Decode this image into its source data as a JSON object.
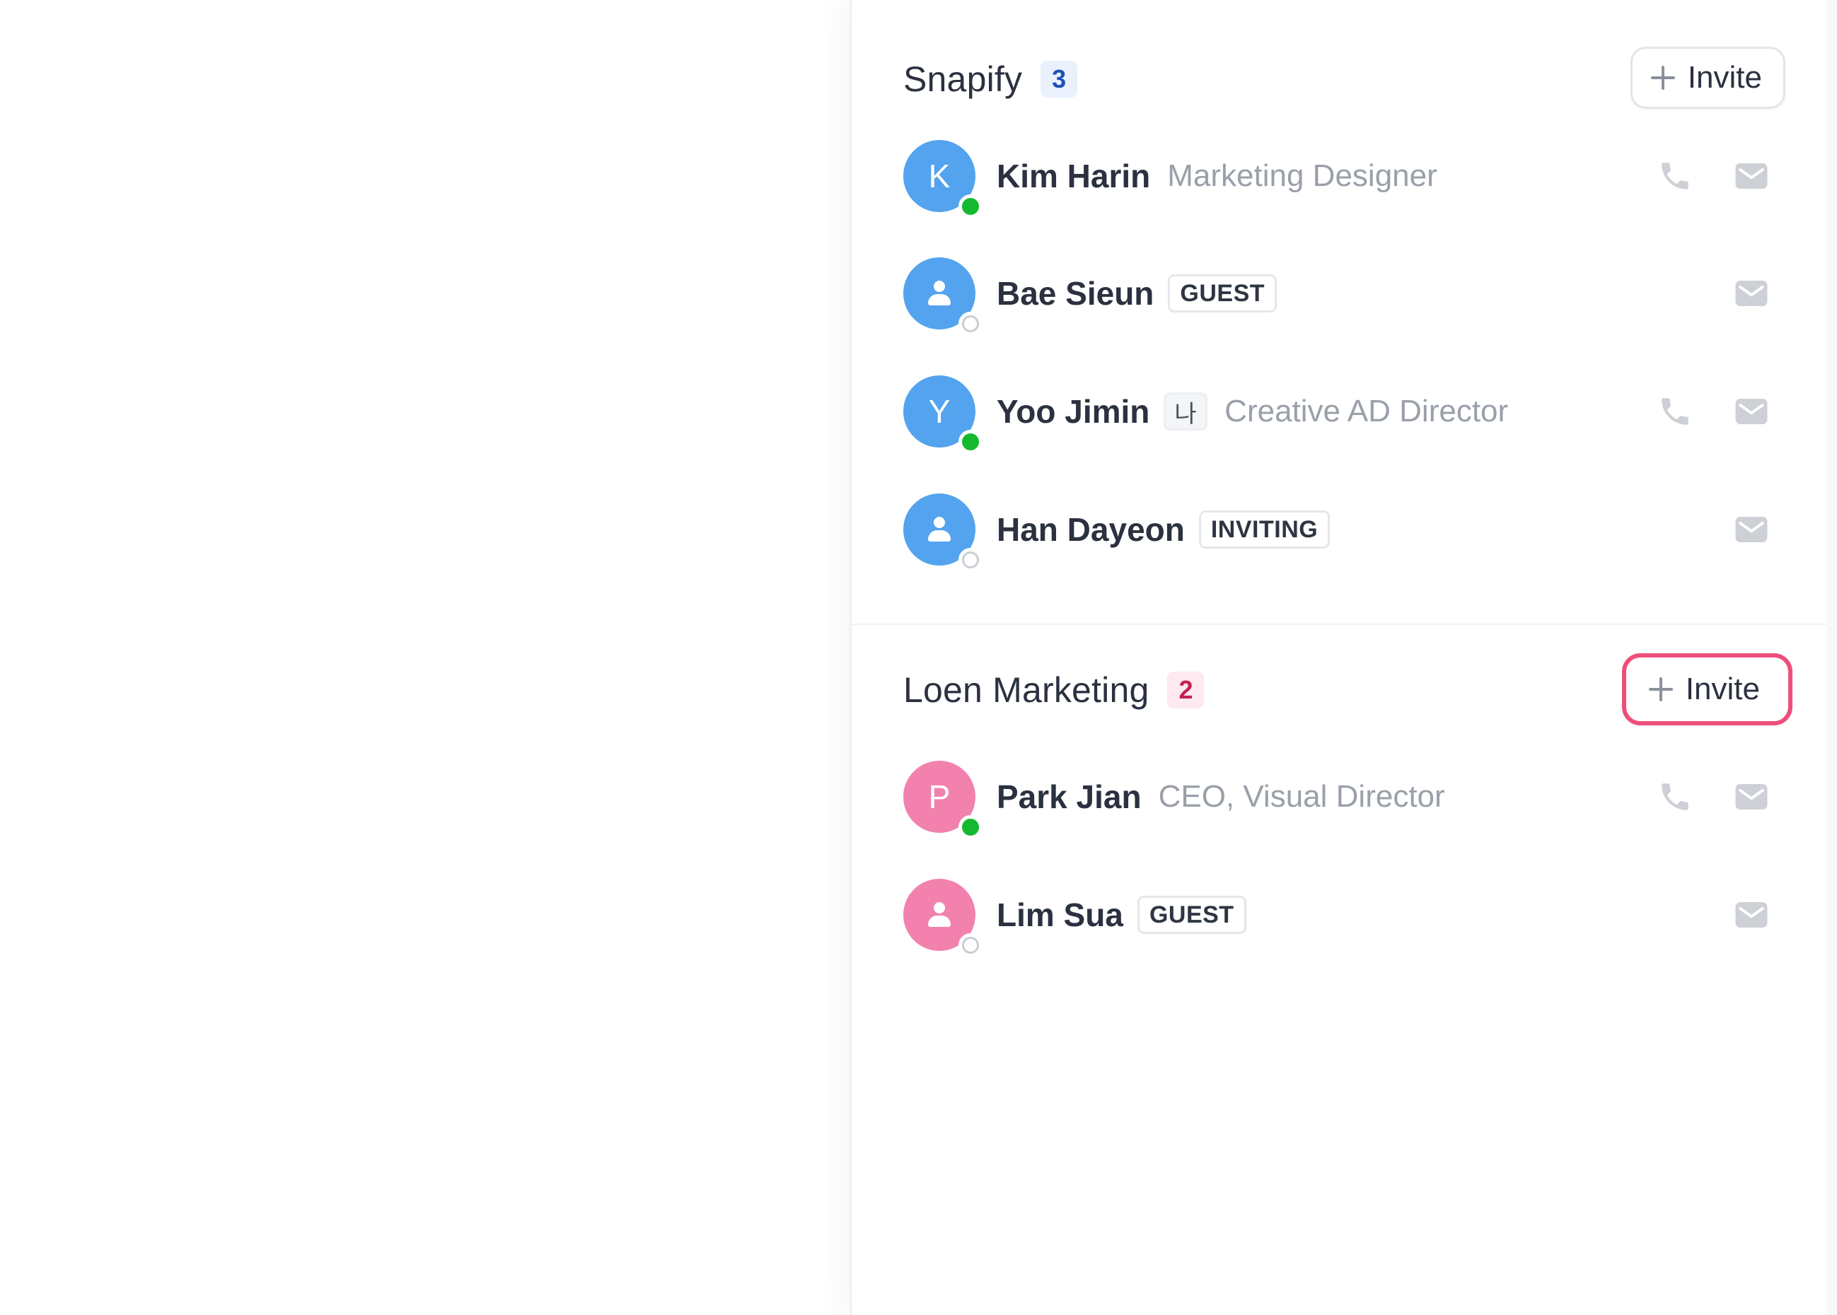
{
  "invite_label": "Invite",
  "colors": {
    "blue_avatar": "#53a3ee",
    "pink_avatar": "#f281ad",
    "online": "#14b92f",
    "focus_ring": "#ee4e7c"
  },
  "icons": {
    "phone": "phone-icon",
    "mail": "mail-icon",
    "plus": "plus-icon",
    "person": "person-icon"
  },
  "teams": [
    {
      "name": "Snapify",
      "count": "3",
      "members": [
        {
          "initial": "K",
          "name": "Kim Harin",
          "role": "Marketing Designer",
          "status": "online",
          "has_phone": true
        },
        {
          "initial": "",
          "name": "Bae Sieun",
          "tag": "GUEST",
          "status": "offline",
          "has_phone": false
        },
        {
          "initial": "Y",
          "name": "Yoo Jimin",
          "me_tag": "나",
          "role": "Creative AD Director",
          "status": "online",
          "has_phone": true
        },
        {
          "initial": "",
          "name": "Han Dayeon",
          "tag": "INVITING",
          "status": "offline",
          "has_phone": false
        }
      ]
    },
    {
      "name": "Loen Marketing",
      "count": "2",
      "members": [
        {
          "initial": "P",
          "name": "Park Jian",
          "role": "CEO, Visual Director",
          "status": "online",
          "has_phone": true
        },
        {
          "initial": "",
          "name": "Lim Sua",
          "tag": "GUEST",
          "status": "offline",
          "has_phone": false
        }
      ]
    }
  ]
}
